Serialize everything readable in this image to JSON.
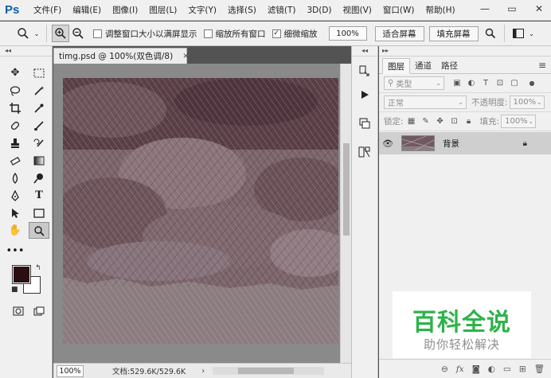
{
  "menubar": {
    "logo": "Ps",
    "items": [
      "文件(F)",
      "编辑(E)",
      "图像(I)",
      "图层(L)",
      "文字(Y)",
      "选择(S)",
      "滤镜(T)",
      "3D(D)",
      "视图(V)",
      "窗口(W)",
      "帮助(H)"
    ],
    "window_buttons": [
      "—",
      "▭",
      "✕"
    ]
  },
  "options": {
    "resize_windows_label": "调整窗口大小以满屏显示",
    "resize_windows_checked": false,
    "zoom_all_label": "缩放所有窗口",
    "zoom_all_checked": false,
    "scrubby_zoom_label": "细微缩放",
    "scrubby_zoom_checked": true,
    "zoom_value": "100%",
    "fit_screen_label": "适合屏幕",
    "fill_screen_label": "填充屏幕"
  },
  "document": {
    "tab_title": "timg.psd @ 100%(双色调/8)",
    "close_glyph": "×"
  },
  "status": {
    "zoom": "100%",
    "doc_info": "文档:529.6K/529.6K",
    "arrow": "›"
  },
  "layers_panel": {
    "tabs": [
      "图层",
      "通道",
      "路径"
    ],
    "active_tab": "图层",
    "filter_kind": "类型",
    "blend_mode": "正常",
    "opacity_label": "不透明度:",
    "opacity_value": "100%",
    "lock_label": "锁定:",
    "fill_label": "填充:",
    "fill_value": "100%",
    "layers": [
      {
        "name": "背景",
        "visible": true,
        "locked": true
      }
    ],
    "bottom_icons": [
      "link-icon",
      "fx-icon",
      "mask-icon",
      "adjustment-icon",
      "group-icon",
      "new-layer-icon",
      "trash-icon"
    ],
    "fx_label": "fx"
  },
  "watermark": {
    "title": "百科全说",
    "subtitle": "助你轻松解决",
    "title_color": "#2db34a"
  },
  "colors": {
    "foreground": "#2a0f10",
    "background": "#ffffff",
    "canvas_tone": "#7e6e72"
  }
}
